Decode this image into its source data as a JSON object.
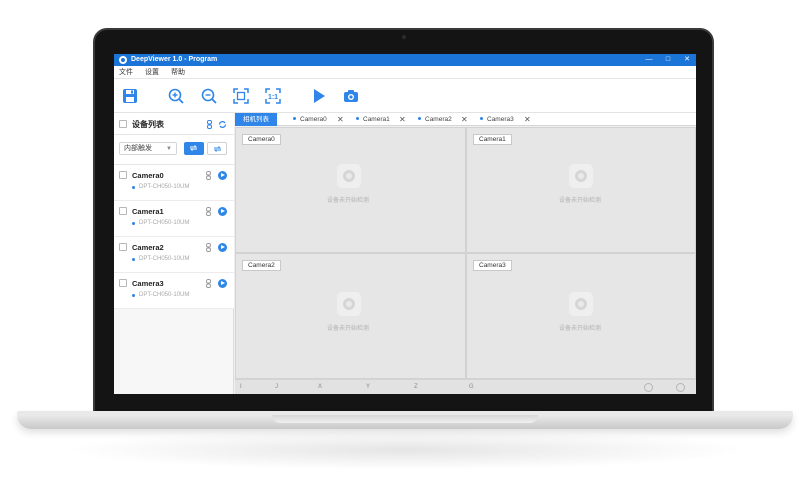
{
  "app": {
    "title": "DeepViewer 1.0 - Program",
    "window_buttons": [
      "—",
      "□",
      "✕"
    ]
  },
  "menu": [
    "文件",
    "设置",
    "帮助"
  ],
  "toolbar": {
    "icons": [
      "save-icon",
      "zoom-in-icon",
      "zoom-out-icon",
      "fit-window-icon",
      "actual-size-icon",
      "play-icon",
      "snapshot-icon"
    ]
  },
  "sidebar": {
    "title": "设备列表",
    "trigger_mode": "内部触发",
    "cameras": [
      {
        "name": "Camera0",
        "model": "DPT-CH050-10UM"
      },
      {
        "name": "Camera1",
        "model": "DPT-CH050-10UM"
      },
      {
        "name": "Camera2",
        "model": "DPT-CH050-10UM"
      },
      {
        "name": "Camera3",
        "model": "DPT-CH050-10UM"
      }
    ]
  },
  "tabs": [
    {
      "label": "相机列表",
      "active": true
    },
    {
      "label": "Camera0",
      "active": false
    },
    {
      "label": "Camera1",
      "active": false
    },
    {
      "label": "Camera2",
      "active": false
    },
    {
      "label": "Camera3",
      "active": false
    }
  ],
  "panes": [
    {
      "label": "Camera0",
      "status": "设备未开始检测"
    },
    {
      "label": "Camera1",
      "status": "设备未开始检测"
    },
    {
      "label": "Camera2",
      "status": "设备未开始检测"
    },
    {
      "label": "Camera3",
      "status": "设备未开始检测"
    }
  ],
  "statusbar": {
    "items": [
      "I",
      "J",
      "X",
      "Y",
      "Z",
      "G"
    ]
  },
  "colors": {
    "accent": "#2f86e8",
    "titlebar": "#1b75d8"
  }
}
